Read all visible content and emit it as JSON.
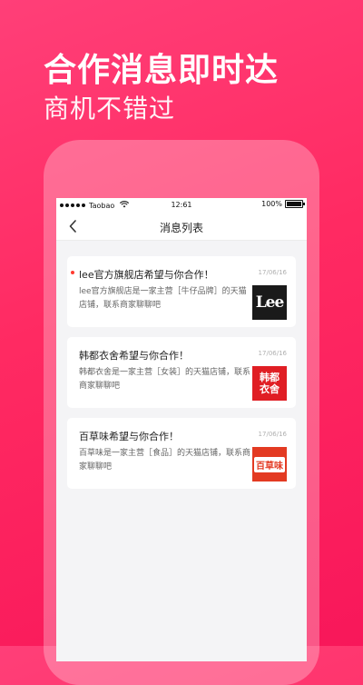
{
  "promo": {
    "title": "合作消息即时达",
    "subtitle": "商机不错过"
  },
  "status_bar": {
    "carrier": "Taobao",
    "time": "12:61",
    "battery": "100%"
  },
  "nav": {
    "title": "消息列表"
  },
  "messages": [
    {
      "title": "lee官方旗舰店希望与你合作！",
      "date": "17/06/16",
      "body": "lee官方旗舰店是一家主营［牛仔品牌］的天猫店铺，联系商家聊聊吧",
      "logo_text": "Lee",
      "unread": true
    },
    {
      "title": "韩都衣舍希望与你合作！",
      "date": "17/06/16",
      "body": "韩都衣舍是一家主营［女装］的天猫店铺，联系商家聊聊吧",
      "logo_text_line1": "韩都",
      "logo_text_line2": "衣舍",
      "unread": false
    },
    {
      "title": "百草味希望与你合作！",
      "date": "17/06/16",
      "body": "百草味是一家主营［食品］的天猫店铺，联系商家聊聊吧",
      "logo_text": "百草味",
      "unread": false
    }
  ],
  "colors": {
    "background": "#ff2a62",
    "unread_dot": "#ff3b30"
  }
}
